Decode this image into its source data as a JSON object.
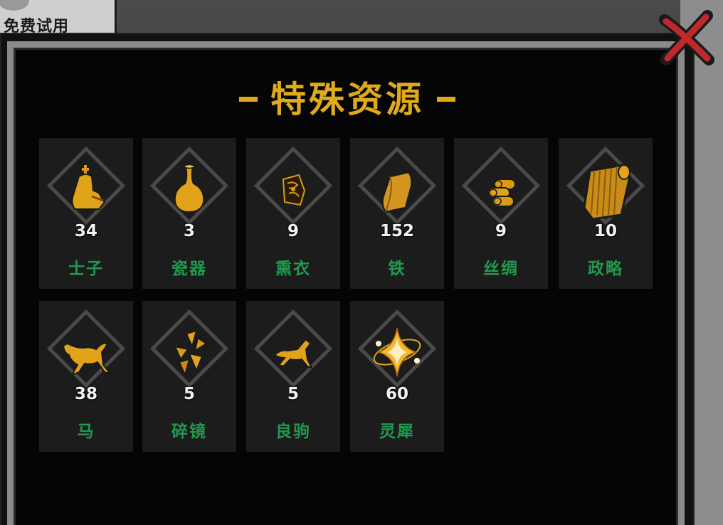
{
  "header": {
    "tab_label": "免费试用",
    "title": "特殊资源"
  },
  "colors": {
    "title": "#e0ab1a",
    "name": "#1f9a4e",
    "count": "#f2f2f2",
    "close": "#c0282a"
  },
  "resources": [
    {
      "name": "士子",
      "count": "34",
      "icon": "scholar-icon"
    },
    {
      "name": "瓷器",
      "count": "3",
      "icon": "vase-icon"
    },
    {
      "name": "熏衣",
      "count": "9",
      "icon": "incense-cloth-icon"
    },
    {
      "name": "铁",
      "count": "152",
      "icon": "iron-ingot-icon"
    },
    {
      "name": "丝绸",
      "count": "9",
      "icon": "silk-rolls-icon"
    },
    {
      "name": "政略",
      "count": "10",
      "icon": "scroll-icon"
    },
    {
      "name": "马",
      "count": "38",
      "icon": "galloping-horse-icon"
    },
    {
      "name": "碎镜",
      "count": "5",
      "icon": "broken-mirror-icon"
    },
    {
      "name": "良驹",
      "count": "5",
      "icon": "fine-horse-icon"
    },
    {
      "name": "灵犀",
      "count": "60",
      "icon": "spirit-star-icon"
    }
  ]
}
